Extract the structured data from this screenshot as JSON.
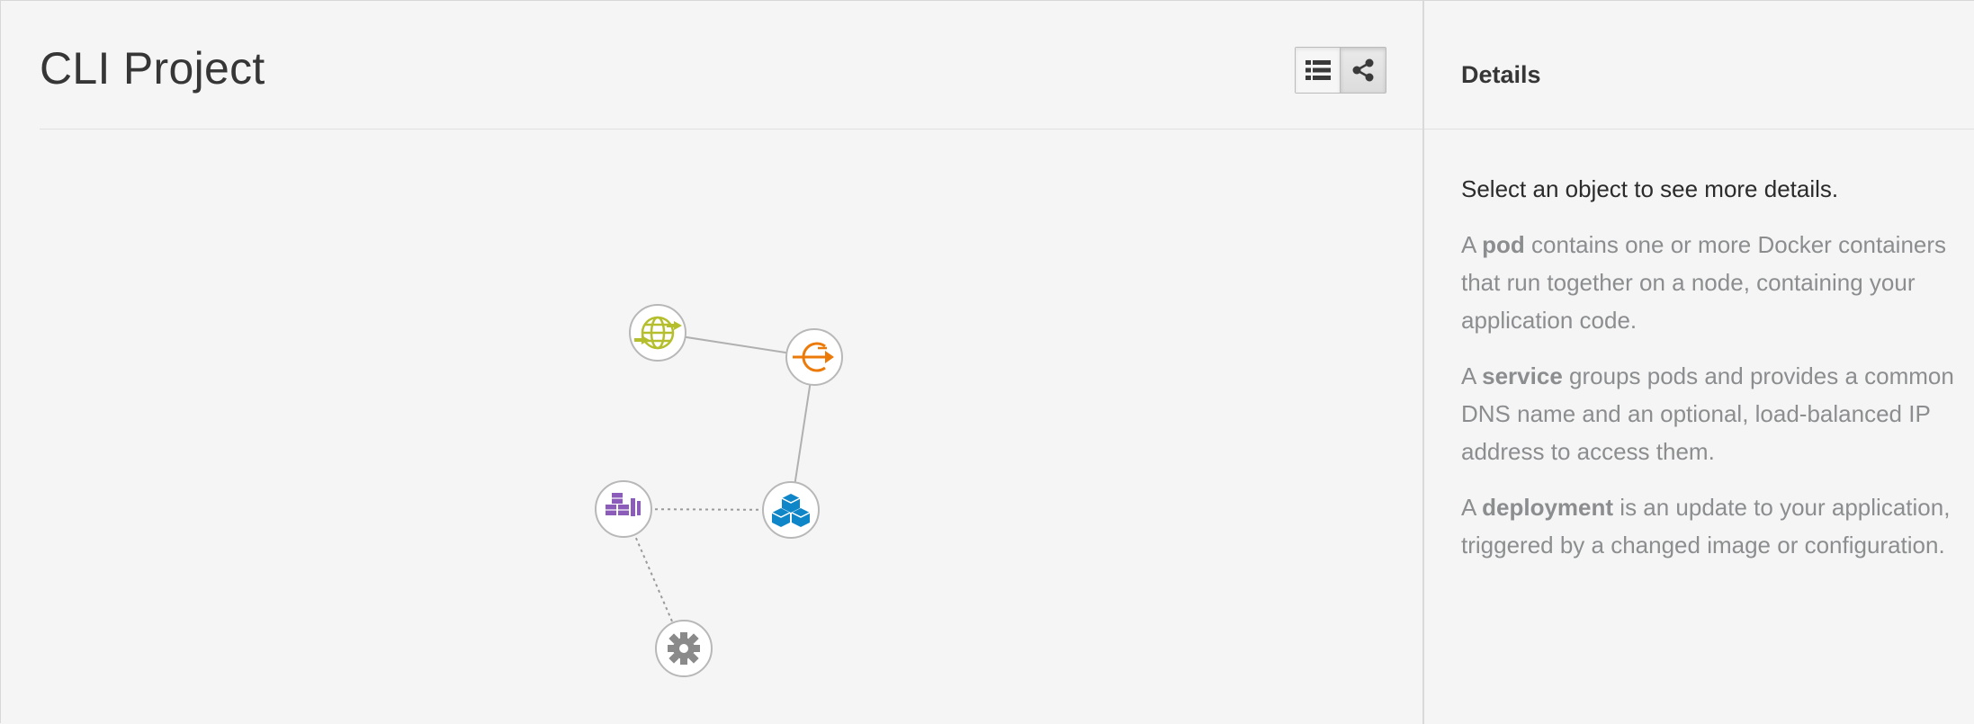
{
  "header": {
    "title": "CLI Project",
    "view_toggle": {
      "list_view_icon": "list-icon",
      "topology_view_icon": "share-icon",
      "active": "topology"
    }
  },
  "topology": {
    "nodes": [
      {
        "name": "route-node",
        "icon": "globe-arrows-icon",
        "color": "#b5bf2d"
      },
      {
        "name": "service-node",
        "icon": "service-arrow-icon",
        "color": "#ec7a08"
      },
      {
        "name": "deployment-config-node",
        "icon": "stacked-boxes-icon",
        "color": "#8b5cb9"
      },
      {
        "name": "pod-node",
        "icon": "cubes-icon",
        "color": "#0f86c8"
      },
      {
        "name": "build-config-node",
        "icon": "gear-icon",
        "color": "#8a8a8a"
      }
    ]
  },
  "sidebar": {
    "title": "Details",
    "lead": "Select an object to see more details.",
    "help": [
      {
        "prefix": "A ",
        "term": "pod",
        "suffix": " contains one or more Docker containers that run together on a node, containing your application code."
      },
      {
        "prefix": "A ",
        "term": "service",
        "suffix": " groups pods and provides a common DNS name and an optional, load-balanced IP address to access them."
      },
      {
        "prefix": "A ",
        "term": "deployment",
        "suffix": " is an update to your application, triggered by a changed image or configuration."
      }
    ]
  }
}
